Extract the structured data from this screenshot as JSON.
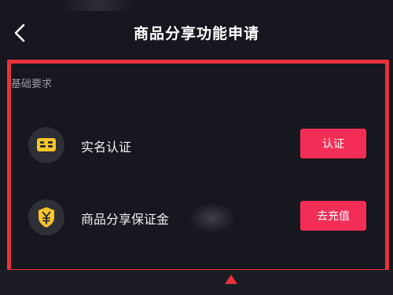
{
  "header": {
    "title": "商品分享功能申请",
    "back_icon": "chevron-left-icon"
  },
  "section": {
    "label": "基础要求"
  },
  "requirements": [
    {
      "icon": "id-card-icon",
      "label": "实名认证",
      "action": "认证"
    },
    {
      "icon": "yuan-shield-icon",
      "label": "商品分享保证金",
      "action": "去充值"
    }
  ],
  "colors": {
    "background": "#17171f",
    "accent": "#f22e56",
    "highlight_frame": "#e8323c",
    "icon_yellow": "#f7c52b",
    "icon_bg": "#2f2f36"
  }
}
